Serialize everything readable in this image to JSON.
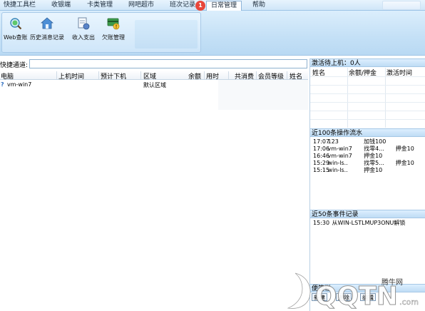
{
  "menu": {
    "items": [
      "快捷工具栏",
      "收银端",
      "卡类管理",
      "网吧超市",
      "班次记录",
      "日常管理",
      "帮助"
    ],
    "active_index": 5,
    "notification_count": "1"
  },
  "ribbon": {
    "buttons": [
      {
        "label": "Web查账",
        "icon": "web-search-icon"
      },
      {
        "label": "历史消息记录",
        "icon": "home-history-icon"
      },
      {
        "label": "收入支出",
        "icon": "document-money-icon"
      },
      {
        "label": "欠账管理",
        "icon": "debt-card-icon"
      }
    ]
  },
  "quick_channel": {
    "label": "快捷通道:",
    "value": ""
  },
  "grid": {
    "headers": [
      "电脑",
      "上机时间",
      "预计下机",
      "区域",
      "余额",
      "用时",
      "共消费",
      "会员等级",
      "姓名"
    ],
    "rows": [
      {
        "computer": "vm-win7",
        "start_time": "",
        "expected_end": "",
        "area": "默认区域",
        "balance": "",
        "duration": "",
        "total_spent": "",
        "member_level": "",
        "name": "",
        "status_icon": "question-mark-icon"
      }
    ]
  },
  "activation_panel": {
    "title": "激活待上机：0人",
    "headers": [
      "姓名",
      "余额/押金",
      "激活时间"
    ]
  },
  "operation_log": {
    "title": "近100条操作流水",
    "entries": [
      {
        "time": "17:07",
        "who": "123",
        "action": "加钱100",
        "extra": ""
      },
      {
        "time": "17:06",
        "who": "vm-win7",
        "action": "找零4...",
        "extra": "押金10"
      },
      {
        "time": "16:46",
        "who": "vm-win7",
        "action": "押金10",
        "extra": ""
      },
      {
        "time": "15:29",
        "who": "win-ls..",
        "action": "找零5...",
        "extra": "押金10"
      },
      {
        "time": "15:15",
        "who": "win-ls..",
        "action": "押金10",
        "extra": ""
      }
    ]
  },
  "event_log": {
    "title": "近50条事件记录",
    "entries": [
      {
        "time": "15:30",
        "text": "从WIN-LSTLMUP3ONU解锁"
      }
    ]
  },
  "sticky": {
    "title": "便签栏",
    "buttons": [
      "新建",
      "删除",
      "编辑"
    ]
  },
  "watermark": {
    "site_text": "腾牛网"
  },
  "colors": {
    "menu_bg": "#cfe6f8",
    "ribbon_bg": "#c4e0f6",
    "section_title_bg": "#bfdcf5",
    "badge": "#e8473b"
  }
}
